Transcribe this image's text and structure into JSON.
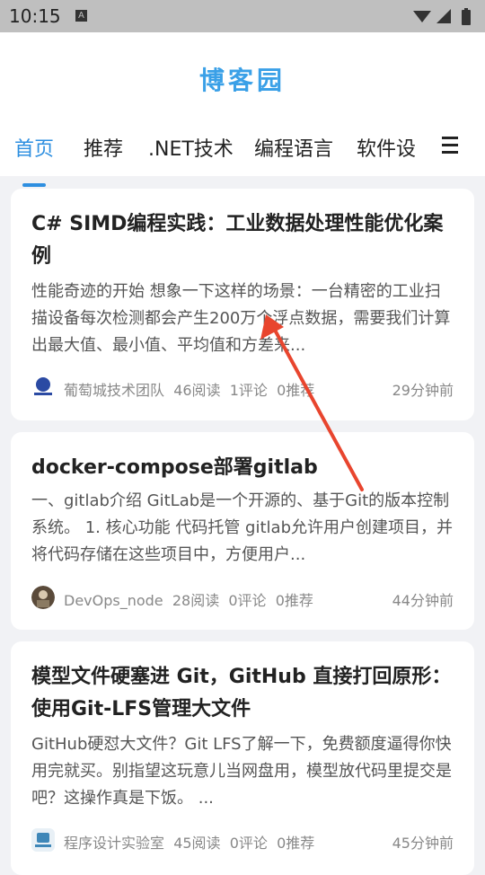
{
  "status_bar": {
    "time": "10:15",
    "notification_icon": "A"
  },
  "header": {
    "logo": "博客园",
    "tabs": [
      "首页",
      "推荐",
      ".NET技术",
      "编程语言",
      "软件设"
    ]
  },
  "posts": [
    {
      "title": "C# SIMD编程实践：工业数据处理性能优化案例",
      "summary": "性能奇迹的开始 想象一下这样的场景：一台精密的工业扫描设备每次检测都会产生200万个浮点数据，需要我们计算出最大值、最小值、平均值和方差来...",
      "author": "葡萄城技术团队",
      "reads": "46阅读",
      "comments": "1评论",
      "recommends": "0推荐",
      "time": "29分钟前"
    },
    {
      "title": "docker-compose部署gitlab",
      "summary": "一、gitlab介绍 GitLab是一个开源的、基于Git的版本控制系统。 1. 核心功能 代码托管 gitlab允许用户创建项目，并将代码存储在这些项目中，方便用户...",
      "author": "DevOps_node",
      "reads": "28阅读",
      "comments": "0评论",
      "recommends": "0推荐",
      "time": "44分钟前"
    },
    {
      "title": "模型文件硬塞进 Git，GitHub 直接打回原形：使用Git-LFS管理大文件",
      "summary": "GitHub硬怼大文件？Git LFS了解一下，免费额度逼得你快用完就买。别指望这玩意儿当网盘用，模型放代码里提交是吧？这操作真是下饭。 ...",
      "author": "程序设计实验室",
      "reads": "45阅读",
      "comments": "0评论",
      "recommends": "0推荐",
      "time": "45分钟前"
    }
  ],
  "annotation": {
    "color": "#e8452e"
  }
}
